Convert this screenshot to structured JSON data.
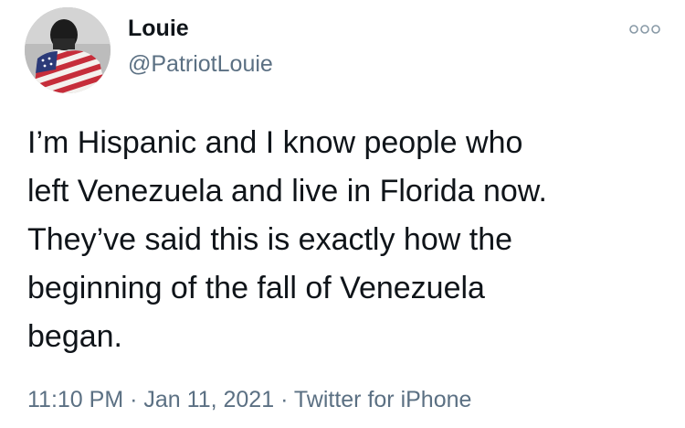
{
  "author": {
    "display_name": "Louie",
    "handle": "@PatriotLouie",
    "avatar_icon": "avatar-photo-flag"
  },
  "menu": {
    "icon": "more-options-icon"
  },
  "tweet": {
    "lines": [
      "I’m Hispanic and I know people who",
      "left Venezuela and live in Florida now.",
      "They’ve said this is exactly how the",
      "beginning of the fall of Venezuela",
      "began."
    ]
  },
  "meta": {
    "time": "11:10 PM",
    "separator": "·",
    "date": "Jan 11, 2021",
    "source": "Twitter for iPhone"
  },
  "colors": {
    "text": "#0f1419",
    "secondary": "#5b7083"
  }
}
